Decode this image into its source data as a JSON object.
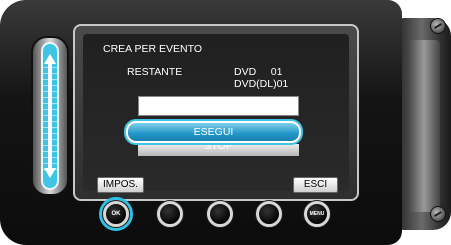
{
  "screen": {
    "title": "CREA PER EVENTO",
    "remaining_label": "RESTANTE",
    "dvd_line1": "DVD     01",
    "dvd_line2": "DVD(DL)01",
    "execute_label": "ESEGUI",
    "stop_label": "STOP"
  },
  "softkeys": {
    "left_label": "IMPOS.",
    "right_label": "ESCI"
  },
  "buttons": {
    "ok_label": "OK",
    "menu_label": "MENU"
  },
  "colors": {
    "accent": "#3fc4e6",
    "selected_button": "#2196c8"
  }
}
